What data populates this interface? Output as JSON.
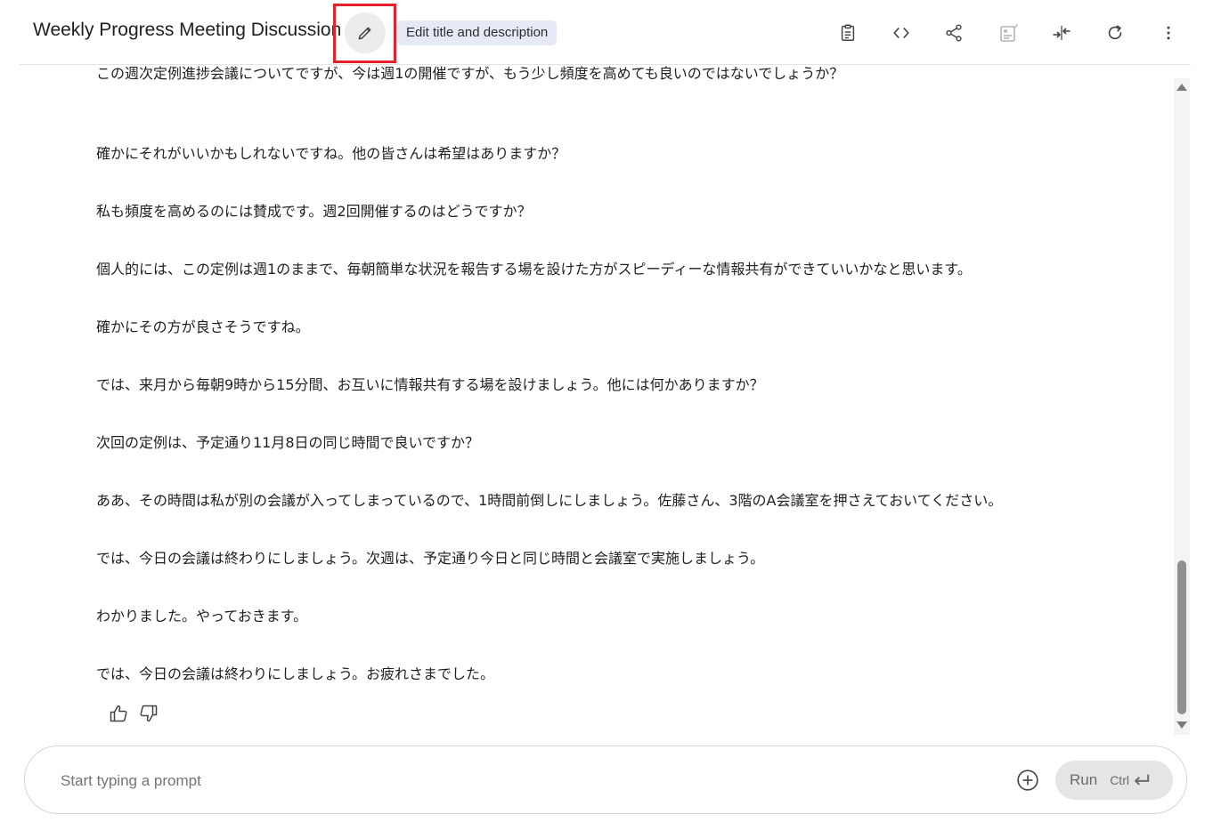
{
  "header": {
    "title": "Weekly Progress Meeting Discussion",
    "tooltip": "Edit title and description"
  },
  "messages": [
    {
      "text": "この週次定例進捗会議についてですが、今は週1の開催ですが、もう少し頻度を高めても良いのではないでしょうか？"
    },
    {
      "text": "確かにそれがいいかもしれないですね。他の皆さんは希望はありますか？"
    },
    {
      "text": "私も頻度を高めるのには賛成です。週2回開催するのはどうですか？"
    },
    {
      "text": "個人的には、この定例は週1のままで、毎朝簡単な状況を報告する場を設けた方がスピーディーな情報共有ができていいかなと思います。"
    },
    {
      "text": "確かにその方が良さそうですね。"
    },
    {
      "text": "では、来月から毎朝9時から15分間、お互いに情報共有する場を設けましょう。他には何かありますか？"
    },
    {
      "text": "次回の定例は、予定通り11月8日の同じ時間で良いですか？"
    },
    {
      "text": "ああ、その時間は私が別の会議が入ってしまっているので、1時間前倒しにしましょう。佐藤さん、3階のA会議室を押さえておいてください。"
    },
    {
      "text": "では、今日の会議は終わりにしましょう。次週は、予定通り今日と同じ時間と会議室で実施しましょう。"
    },
    {
      "text": "わかりました。やっておきます。"
    },
    {
      "text": "では、今日の会議は終わりにしましょう。お疲れさまでした。"
    }
  ],
  "prompt": {
    "placeholder": "Start typing a prompt",
    "run_label": "Run",
    "shortcut_label": "Ctrl"
  },
  "icons": {
    "edit": "pencil-icon",
    "toolbar": [
      "clipboard-icon",
      "code-icon",
      "share-icon",
      "compare-icon",
      "collapse-icon",
      "refresh-icon",
      "more-vert-icon"
    ],
    "feedback": [
      "thumb-up-icon",
      "thumb-down-icon"
    ],
    "add": "add-circle-icon",
    "enter": "enter-arrow-icon"
  },
  "colors": {
    "highlight": "#e8202a",
    "tooltip_bg": "#e6eaf7",
    "run_bg": "#e5e5e5"
  }
}
